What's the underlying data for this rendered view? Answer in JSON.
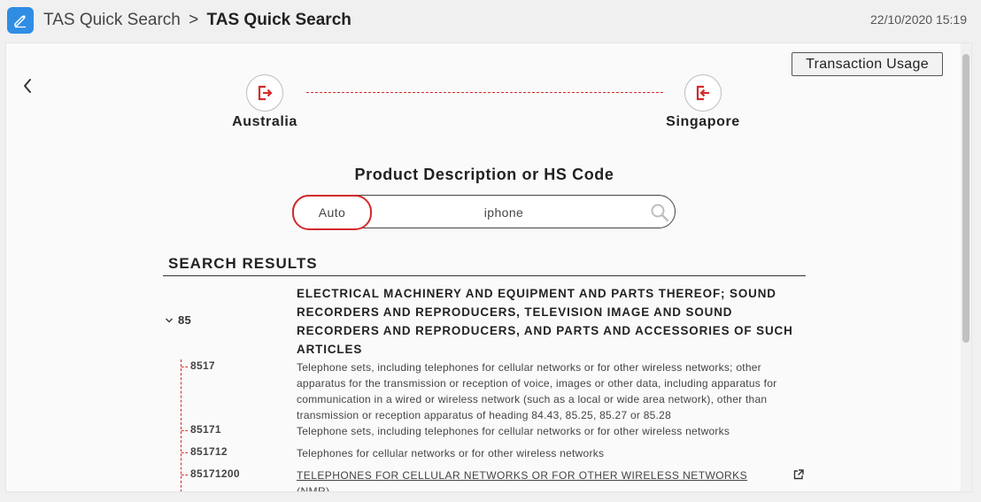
{
  "header": {
    "breadcrumb_root": "TAS Quick Search",
    "breadcrumb_sep": ">",
    "breadcrumb_current": "TAS Quick Search",
    "datetime": "22/10/2020 15:19"
  },
  "toolbar": {
    "transaction_usage_label": "Transaction Usage"
  },
  "route": {
    "origin": "Australia",
    "destination": "Singapore",
    "accent_color": "#d42a2a"
  },
  "search": {
    "title": "Product Description or HS Code",
    "mode": "Auto",
    "query": "iphone"
  },
  "results": {
    "title": "SEARCH RESULTS",
    "heading": {
      "code": "85",
      "description": "ELECTRICAL MACHINERY AND EQUIPMENT AND PARTS THEREOF; SOUND RECORDERS AND REPRODUCERS, TELEVISION IMAGE AND SOUND RECORDERS AND REPRODUCERS, AND PARTS AND ACCESSORIES OF SUCH ARTICLES"
    },
    "items": [
      {
        "code": "8517",
        "description": "Telephone sets, including telephones for cellular networks or for other wireless networks; other apparatus for the transmission or reception of voice, images or other data, including apparatus for communication in a wired or wireless network (such as a local or wide area network), other than transmission or reception apparatus of heading 84.43, 85.25, 85.27 or 85.28"
      },
      {
        "code": "85171",
        "description": "Telephone sets, including telephones for cellular networks or for other wireless networks"
      },
      {
        "code": "851712",
        "description": "Telephones for cellular networks or for other wireless networks"
      },
      {
        "code": "85171200",
        "description": "TELEPHONES FOR CELLULAR NETWORKS OR FOR OTHER WIRELESS NETWORKS (NMR)"
      }
    ]
  },
  "icons": {
    "app": "edit-icon",
    "back": "chevron-left-icon",
    "origin": "export-icon",
    "destination": "import-icon",
    "search": "search-icon",
    "toggle": "chevron-down-icon",
    "external": "external-link-icon"
  }
}
